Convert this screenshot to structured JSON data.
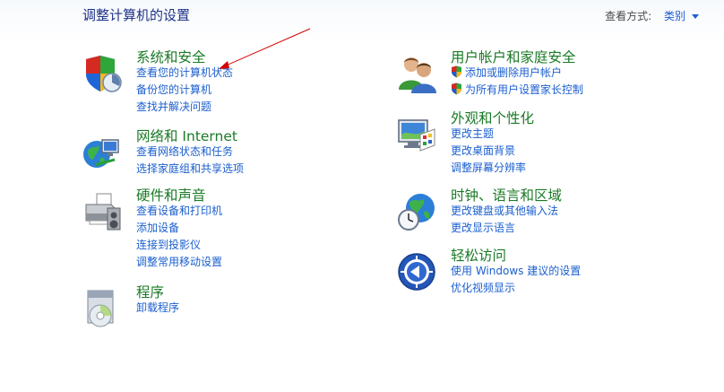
{
  "header": {
    "title": "调整计算机的设置",
    "view_by_label": "查看方式:",
    "view_by_value": "类别"
  },
  "categories": [
    {
      "id": "system",
      "title": "系统和安全",
      "icon": "security-shield-icon",
      "links": [
        "查看您的计算机状态",
        "备份您的计算机",
        "查找并解决问题"
      ]
    },
    {
      "id": "network",
      "title": "网络和 Internet",
      "icon": "network-globe-icon",
      "links": [
        "查看网络状态和任务",
        "选择家庭组和共享选项"
      ]
    },
    {
      "id": "hardware",
      "title": "硬件和声音",
      "icon": "printer-icon",
      "links": [
        "查看设备和打印机",
        "添加设备",
        "连接到投影仪",
        "调整常用移动设置"
      ]
    },
    {
      "id": "programs",
      "title": "程序",
      "icon": "programs-disc-icon",
      "links": [
        "卸载程序"
      ]
    },
    {
      "id": "users",
      "title": "用户帐户和家庭安全",
      "icon": "users-icon",
      "links": [
        "添加或删除用户帐户",
        "为所有用户设置家长控制"
      ]
    },
    {
      "id": "appearance",
      "title": "外观和个性化",
      "icon": "monitor-palette-icon",
      "links": [
        "更改主题",
        "更改桌面背景",
        "调整屏幕分辨率"
      ]
    },
    {
      "id": "clock",
      "title": "时钟、语言和区域",
      "icon": "clock-globe-icon",
      "links": [
        "更改键盘或其他输入法",
        "更改显示语言"
      ]
    },
    {
      "id": "ease",
      "title": "轻松访问",
      "icon": "ease-of-access-icon",
      "links": [
        "使用 Windows 建议的设置",
        "优化视频显示"
      ]
    }
  ],
  "colors": {
    "title_green": "#1a7a26",
    "link_blue": "#1b5fcf",
    "header_blue": "#1e3287",
    "annotation_red": "#d40000"
  }
}
